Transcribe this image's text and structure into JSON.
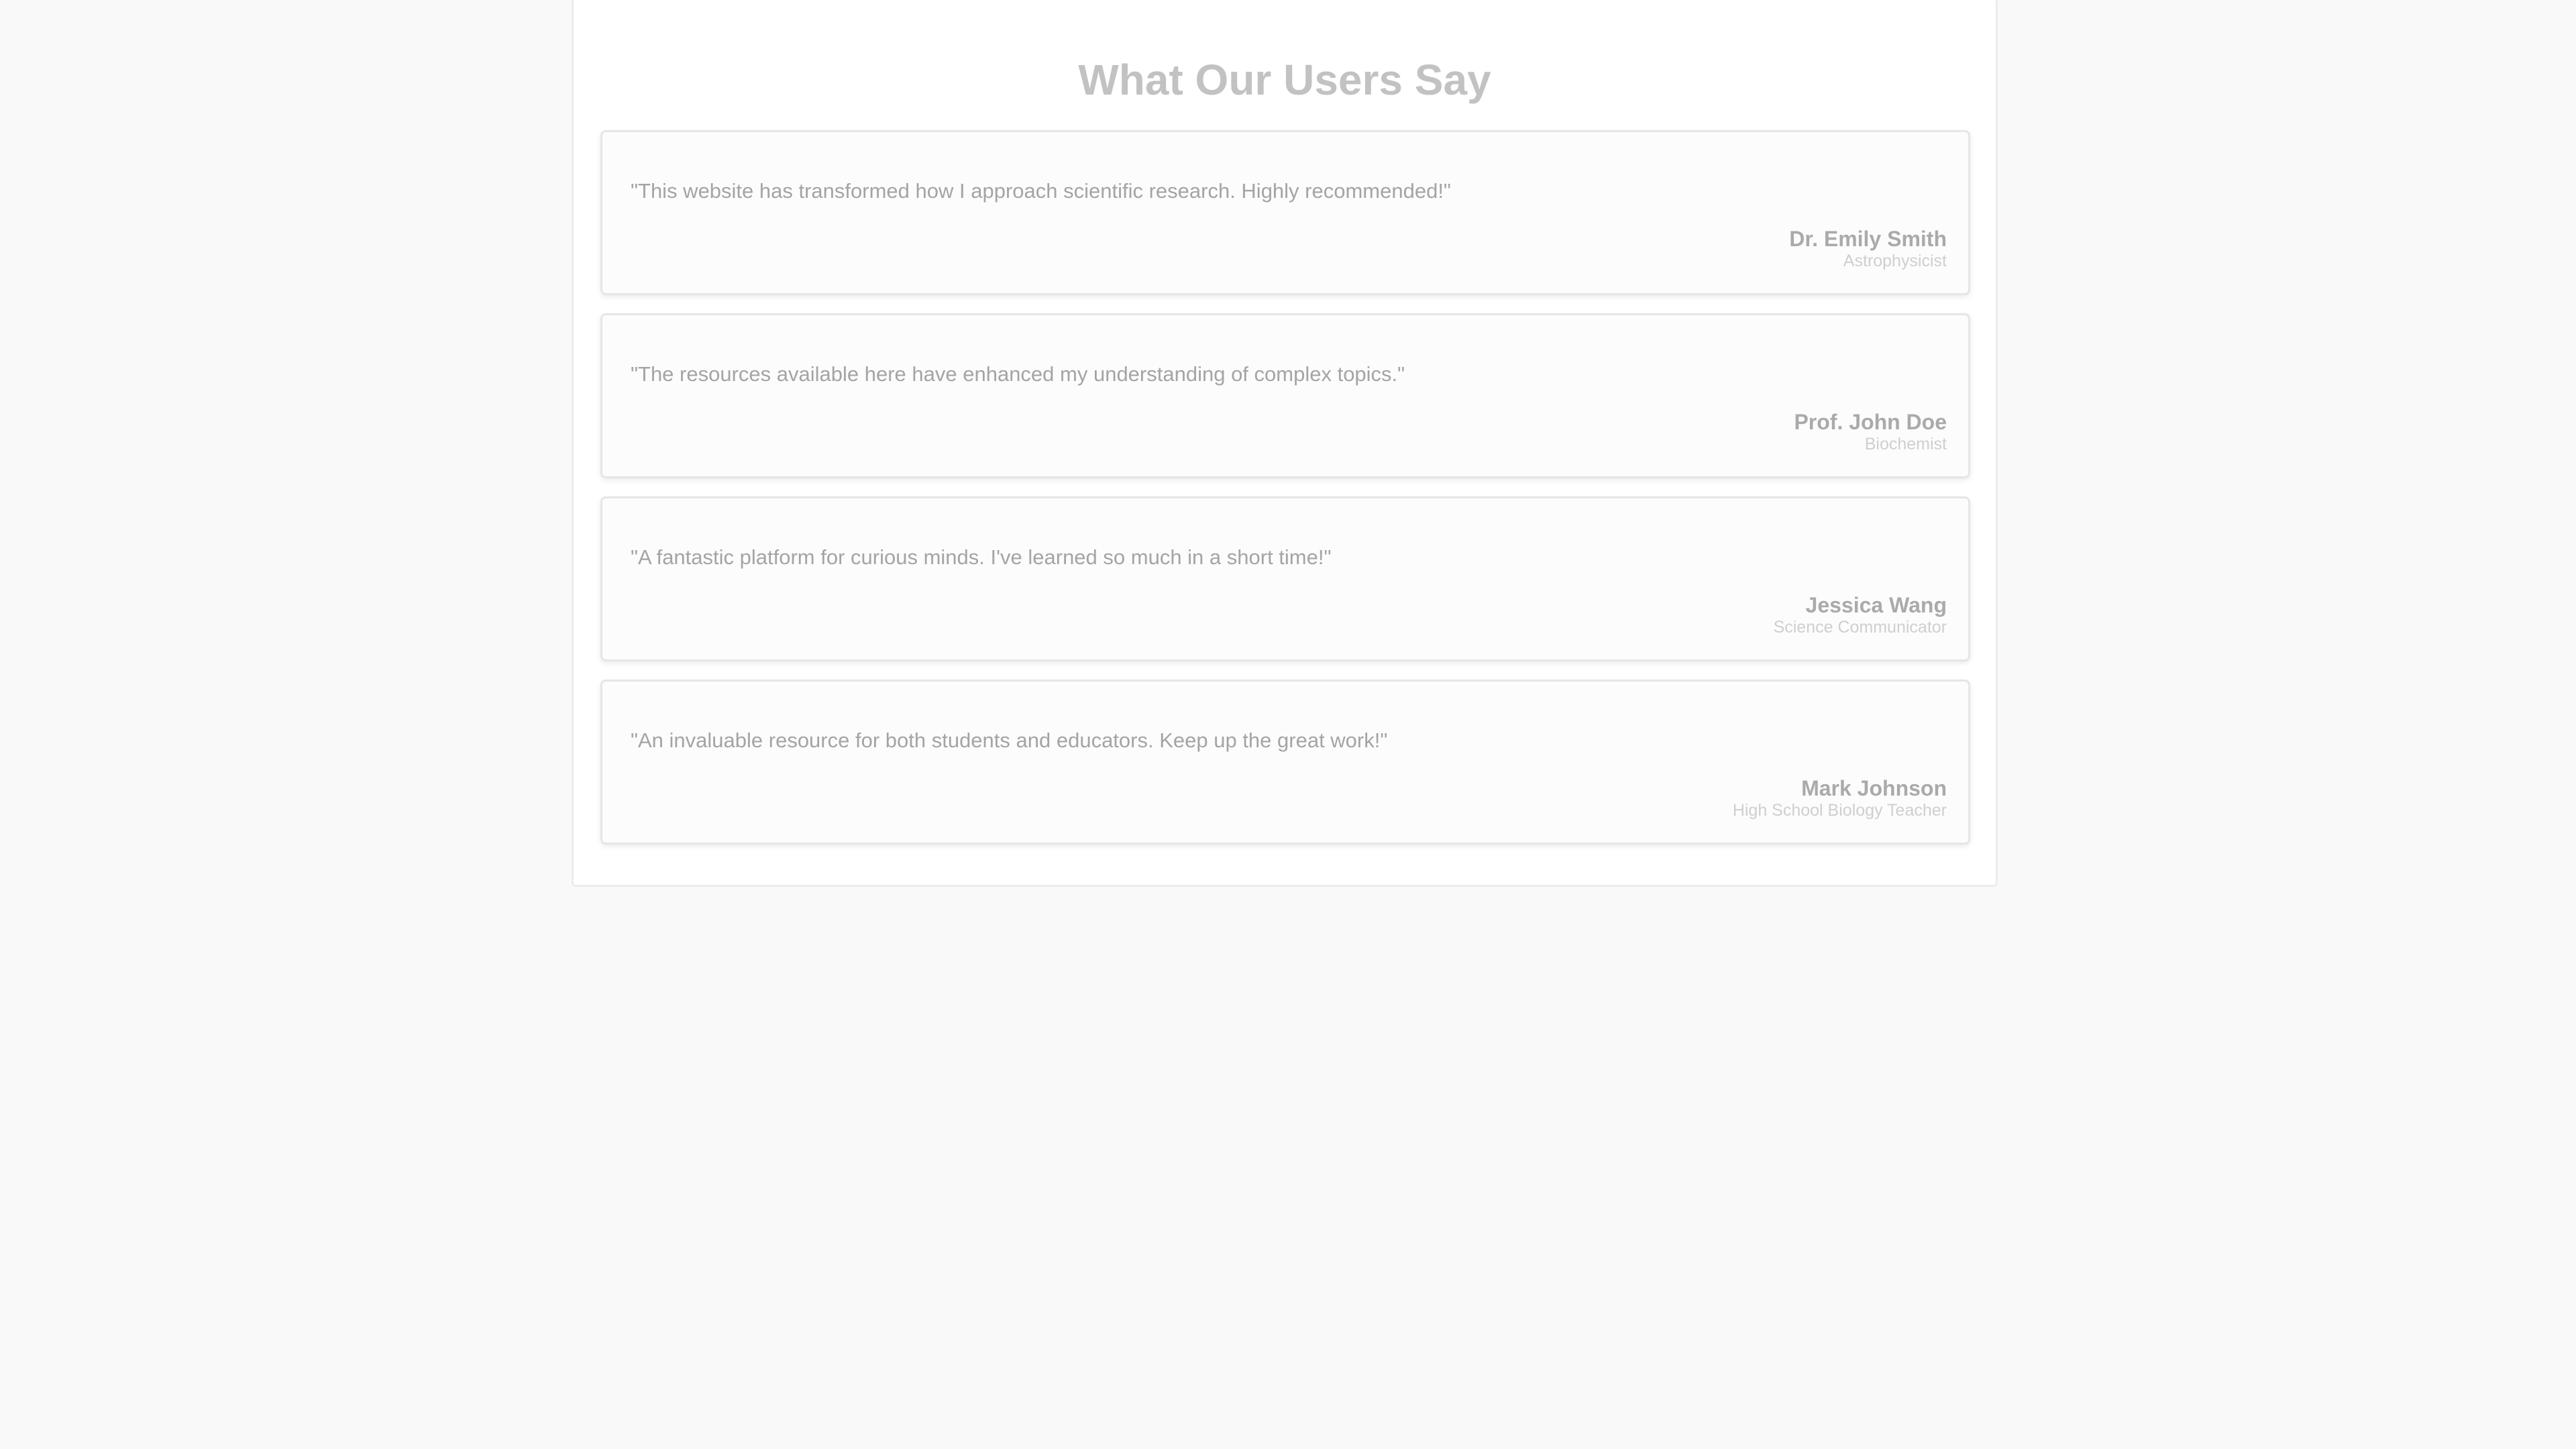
{
  "header": {
    "title": "What Our Users Say"
  },
  "testimonials": [
    {
      "quote": "\"This website has transformed how I approach scientific research. Highly recommended!\"",
      "name": "Dr. Emily Smith",
      "role": "Astrophysicist"
    },
    {
      "quote": "\"The resources available here have enhanced my understanding of complex topics.\"",
      "name": "Prof. John Doe",
      "role": "Biochemist"
    },
    {
      "quote": "\"A fantastic platform for curious minds. I've learned so much in a short time!\"",
      "name": "Jessica Wang",
      "role": "Science Communicator"
    },
    {
      "quote": "\"An invaluable resource for both students and educators. Keep up the great work!\"",
      "name": "Mark Johnson",
      "role": "High School Biology Teacher"
    }
  ]
}
